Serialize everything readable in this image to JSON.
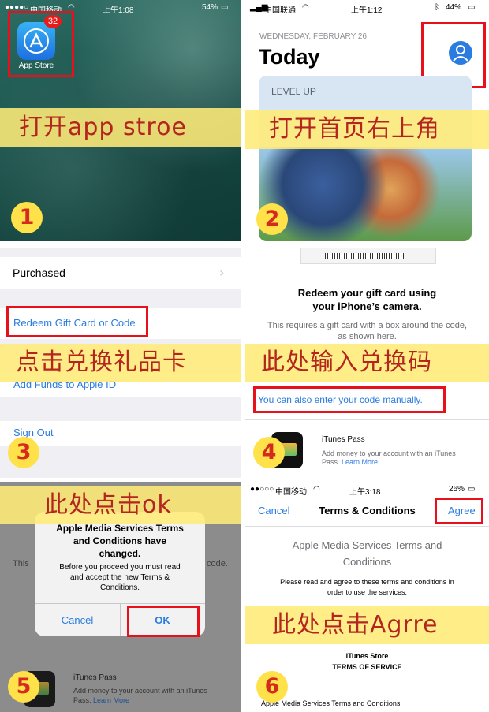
{
  "panel1": {
    "carrier": "中国移动",
    "time": "上午1:08",
    "battery": "54%",
    "app_label": "App Store",
    "badge": "32",
    "caption": "打开app stroe",
    "step": "1"
  },
  "panel2": {
    "carrier": "中国联通",
    "time": "上午1:12",
    "battery": "44%",
    "date": "WEDNESDAY, FEBRUARY 26",
    "title": "Today",
    "card_label": "LEVEL UP",
    "caption": "打开首页右上角",
    "step": "2"
  },
  "panel3": {
    "purchased": "Purchased",
    "redeem": "Redeem Gift Card or Code",
    "add_funds": "Add Funds to Apple ID",
    "sign_out": "Sign Out",
    "caption": "点击兑换礼品卡",
    "step": "3"
  },
  "panel4": {
    "heading_line1": "Redeem your gift card using",
    "heading_line2": "your iPhone’s camera.",
    "desc_line1": "This requires a gift card with a box around the code,",
    "desc_line2": "as shown here.",
    "manual_link": "You can also enter your code manually.",
    "pass_title": "iTunes Pass",
    "pass_desc1": "Add money to your account with an iTunes",
    "pass_desc2": "Pass.",
    "learn_more": "Learn More",
    "caption": "此处输入兑换码",
    "step": "4"
  },
  "panel5": {
    "dialog_title_partial": "Apple Media Services Terms",
    "dialog_title2": "and Conditions have",
    "dialog_title3": "changed.",
    "dialog_body1": "Before you proceed you must read",
    "dialog_body2": "and accept the new Terms &",
    "dialog_body3": "Conditions.",
    "cancel": "Cancel",
    "ok": "OK",
    "bg_left": "This",
    "bg_right": "code.",
    "pass_title": "iTunes Pass",
    "pass_desc1": "Add money to your account with an iTunes",
    "pass_desc2": "Pass.",
    "learn_more": "Learn More",
    "caption": "此处点击ok",
    "step": "5"
  },
  "panel6": {
    "carrier": "中国移动",
    "time": "上午3:18",
    "battery": "26%",
    "cancel": "Cancel",
    "title": "Terms & Conditions",
    "agree": "Agree",
    "heading1": "Apple Media Services Terms and",
    "heading2": "Conditions",
    "body1": "Please read and agree to these terms and conditions in",
    "body2": "order to use the services.",
    "store": "iTunes Store",
    "tos": "TERMS OF SERVICE",
    "footer": "Apple Media Services Terms and Conditions",
    "caption": "此处点击Agrre",
    "step": "6"
  },
  "colors": {
    "ios_blue": "#2a7ce0",
    "highlight_red": "#e8111b",
    "banner_yellow": "#ffec78",
    "step_red": "#d52b1e"
  }
}
